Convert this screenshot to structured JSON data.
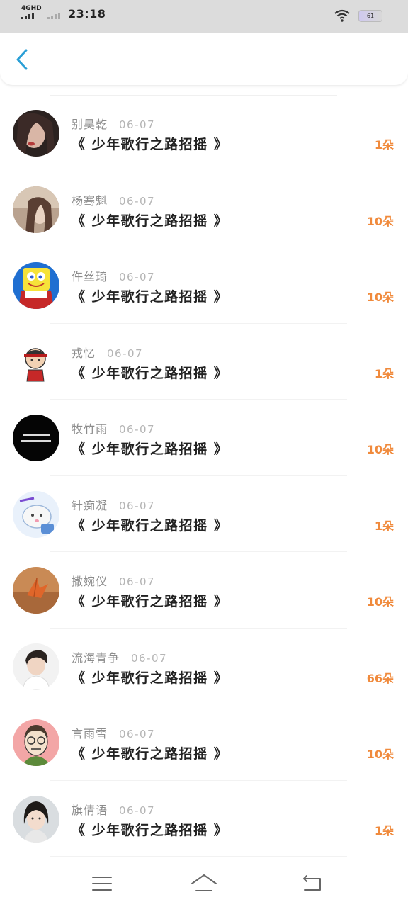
{
  "status_bar": {
    "network": "4GHD",
    "time": "23:18",
    "battery": "61"
  },
  "header": {
    "back_icon": "chevron-left-icon",
    "accent": "#2a9fd6"
  },
  "list": {
    "items": [
      {
        "name": "别昊乾",
        "date": "06-07",
        "title": "《 少年歌行之路招摇 》",
        "count": "1朵"
      },
      {
        "name": "杨骞魁",
        "date": "06-07",
        "title": "《 少年歌行之路招摇 》",
        "count": "10朵"
      },
      {
        "name": "仵丝琦",
        "date": "06-07",
        "title": "《 少年歌行之路招摇 》",
        "count": "10朵"
      },
      {
        "name": "戎忆",
        "date": "06-07",
        "title": "《 少年歌行之路招摇 》",
        "count": "1朵"
      },
      {
        "name": "牧竹雨",
        "date": "06-07",
        "title": "《 少年歌行之路招摇 》",
        "count": "10朵"
      },
      {
        "name": "针痴凝",
        "date": "06-07",
        "title": "《 少年歌行之路招摇 》",
        "count": "1朵"
      },
      {
        "name": "撒婉仪",
        "date": "06-07",
        "title": "《 少年歌行之路招摇 》",
        "count": "10朵"
      },
      {
        "name": "流海青争",
        "date": "06-07",
        "title": "《 少年歌行之路招摇 》",
        "count": "66朵"
      },
      {
        "name": "言雨雪",
        "date": "06-07",
        "title": "《 少年歌行之路招摇 》",
        "count": "10朵"
      },
      {
        "name": "旗倩语",
        "date": "06-07",
        "title": "《 少年歌行之路招摇 》",
        "count": "1朵"
      }
    ],
    "count_color": "#f08a3c"
  },
  "nav": {
    "menu_icon": "menu-icon",
    "home_icon": "home-icon",
    "back_icon": "back-arrow-icon"
  }
}
